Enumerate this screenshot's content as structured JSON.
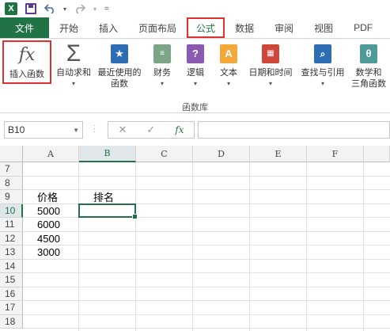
{
  "qat": {
    "undo_icon": "undo-icon",
    "redo_icon": "redo-icon"
  },
  "tabs": [
    {
      "label": "文件"
    },
    {
      "label": "开始"
    },
    {
      "label": "插入"
    },
    {
      "label": "页面布局"
    },
    {
      "label": "公式"
    },
    {
      "label": "数据"
    },
    {
      "label": "审阅"
    },
    {
      "label": "视图"
    },
    {
      "label": "PDF"
    }
  ],
  "ribbon": {
    "buttons": [
      {
        "label": "插入函数",
        "icon": "fx-icon"
      },
      {
        "label": "自动求和",
        "icon": "sigma-icon"
      },
      {
        "label": "最近使用的\n函数",
        "icon": "star-icon"
      },
      {
        "label": "财务",
        "icon": "coins-icon"
      },
      {
        "label": "逻辑",
        "icon": "question-icon"
      },
      {
        "label": "文本",
        "icon": "text-a-icon"
      },
      {
        "label": "日期和时间",
        "icon": "calendar-icon"
      },
      {
        "label": "查找与引用",
        "icon": "magnifier-icon"
      },
      {
        "label": "数学和\n三角函数",
        "icon": "theta-icon"
      }
    ],
    "group_label": "函数库"
  },
  "formula_bar": {
    "name_box": "B10",
    "fx_label": "fx",
    "value": ""
  },
  "grid": {
    "columns": [
      "A",
      "B",
      "C",
      "D",
      "E",
      "F"
    ],
    "rows": [
      "7",
      "8",
      "9",
      "10",
      "11",
      "12",
      "13",
      "14",
      "15",
      "16",
      "17",
      "18"
    ],
    "cells": {
      "A9": "价格",
      "B9": "排名",
      "A10": "5000",
      "A11": "6000",
      "A12": "4500",
      "A13": "3000"
    },
    "selected": "B10"
  }
}
